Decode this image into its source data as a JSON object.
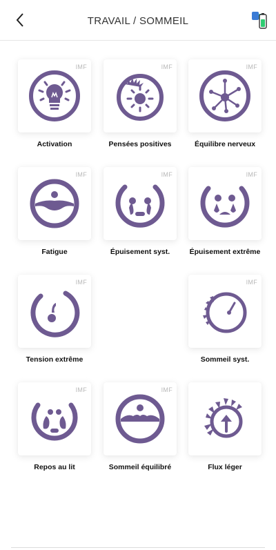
{
  "header": {
    "title": "TRAVAIL / SOMMEIL",
    "back_icon": "chevron-left-icon",
    "status_icon": "battery-device-icon"
  },
  "colors": {
    "accent": "#6e5a91",
    "card": "#ffffff",
    "imf": "#b8b8b8"
  },
  "tiles": [
    {
      "label": "Activation",
      "badge": "IMF",
      "icon": "lightbulb-icon"
    },
    {
      "label": "Pensées positives",
      "badge": "IMF",
      "icon": "sun-icon"
    },
    {
      "label": "Équilibre nerveux",
      "badge": "IMF",
      "icon": "neuron-icon"
    },
    {
      "label": "Fatigue",
      "badge": "IMF",
      "icon": "fatigue-face-icon"
    },
    {
      "label": "Épuisement syst.",
      "badge": "IMF",
      "icon": "exhaustion-icon"
    },
    {
      "label": "Épuisement extrême",
      "badge": "IMF",
      "icon": "extreme-exhaustion-icon"
    },
    {
      "label": "Tension extrême",
      "badge": "IMF",
      "icon": "tension-icon"
    },
    {
      "label": "Sommeil syst.",
      "badge": "IMF",
      "icon": "sleep-system-icon"
    },
    {
      "label": "Repos au lit",
      "badge": "IMF",
      "icon": "bed-rest-icon"
    },
    {
      "label": "Sommeil équilibré",
      "badge": "IMF",
      "icon": "balanced-sleep-icon"
    },
    {
      "label": "Flux léger",
      "badge": "",
      "icon": "light-flow-icon"
    }
  ]
}
